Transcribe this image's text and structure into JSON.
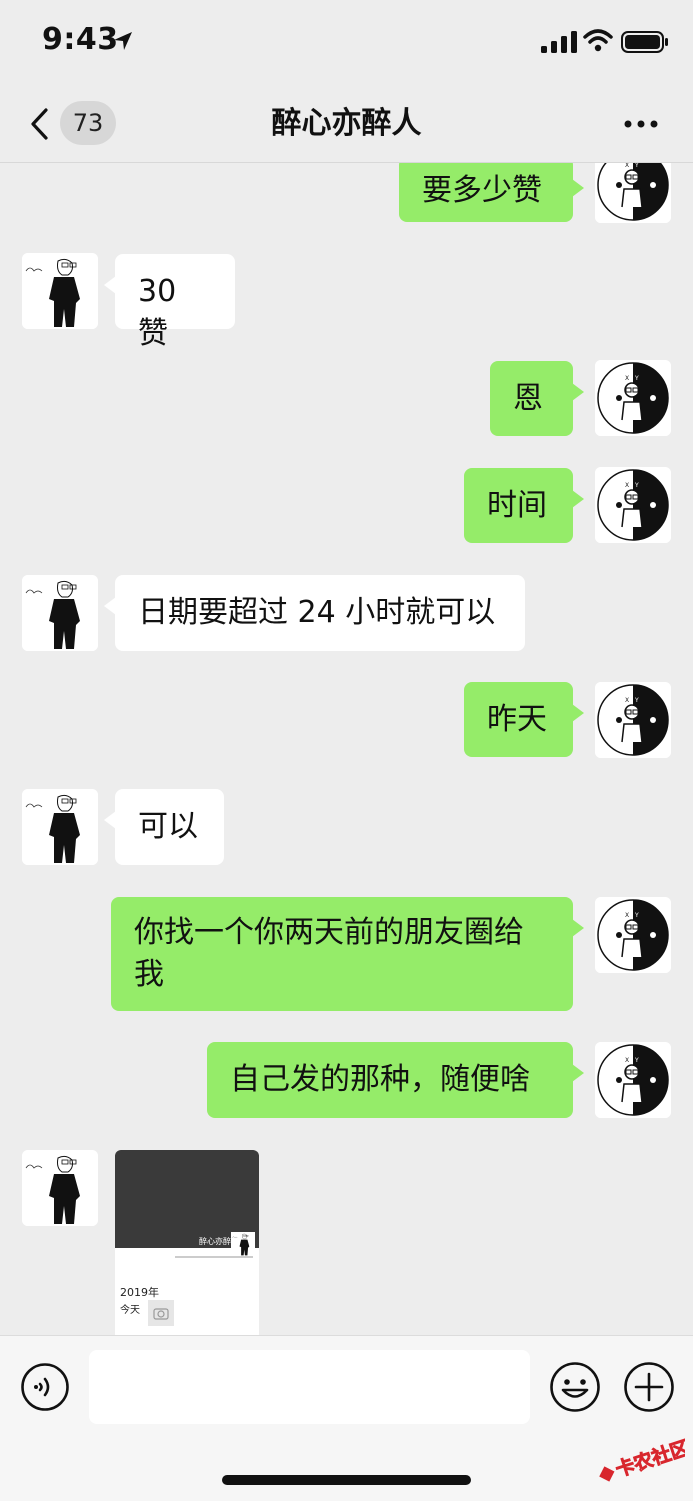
{
  "status_bar": {
    "time": "9:43"
  },
  "header": {
    "back_count": "73",
    "title": "醉心亦醉人"
  },
  "messages": [
    {
      "side": "out",
      "text": "要多少赞"
    },
    {
      "side": "in",
      "text": "30 赞"
    },
    {
      "side": "out",
      "text": "恩"
    },
    {
      "side": "out",
      "text": "时间"
    },
    {
      "side": "in",
      "text": "日期要超过 24 小时就可以"
    },
    {
      "side": "out",
      "text": "昨天"
    },
    {
      "side": "in",
      "text": "可以"
    },
    {
      "side": "out",
      "text": "你找一个你两天前的朋友圈给我"
    },
    {
      "side": "out",
      "text": "自己发的那种，随便啥"
    }
  ],
  "screenshot": {
    "profile_name": "醉心亦醉人",
    "year": "2019年",
    "day": "今天"
  },
  "watermark": "卡农社区"
}
